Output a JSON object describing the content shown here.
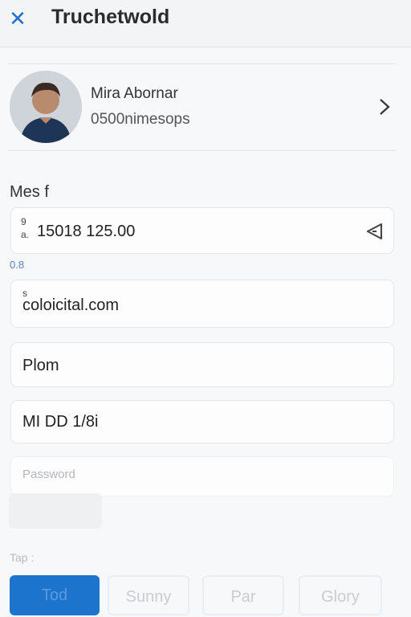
{
  "header": {
    "title": "Truchetwold",
    "close_icon": "close-icon"
  },
  "profile": {
    "name": "Mira Abornar",
    "subtitle": "0500nimesops",
    "chevron_icon": "chevron-right-icon"
  },
  "form": {
    "section_label": "Mes f",
    "phone_field": {
      "prefix_top": "9",
      "prefix_bottom": "a.",
      "value": "15018 125.00",
      "action_icon": "send-icon"
    },
    "note": "0.8",
    "email_field": {
      "small_label": "s",
      "value": "coloicital.com"
    },
    "plan_field": {
      "value": "Plom"
    },
    "date_field": {
      "value": "MI DD 1/8i"
    },
    "password_field": {
      "placeholder": "Password"
    }
  },
  "bottom": {
    "row_label": "Tap :",
    "segments": [
      "Tod",
      "Sunny",
      "Par",
      "Glory"
    ],
    "active_index": 0
  },
  "colors": {
    "accent": "#1c74cc",
    "close": "#1f6fd1"
  }
}
